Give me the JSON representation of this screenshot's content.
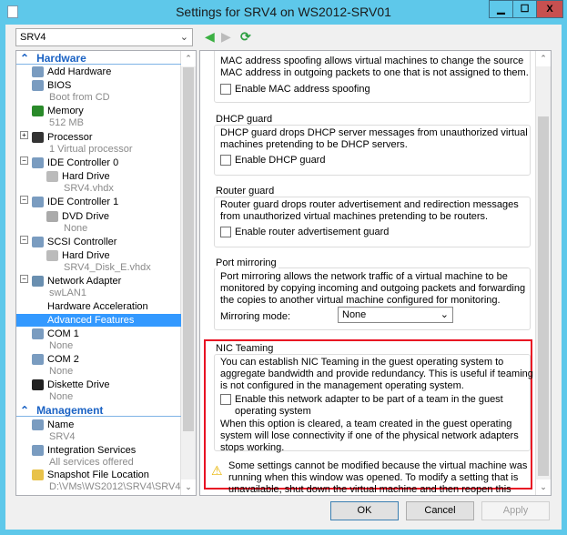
{
  "window": {
    "title": "Settings for SRV4 on WS2012-SRV01",
    "minimize": "▁",
    "maximize": "☐",
    "close": "X"
  },
  "vm_selector": {
    "value": "SRV4"
  },
  "tree": {
    "sections": {
      "hardware": "Hardware",
      "management": "Management"
    },
    "items": [
      {
        "label": "Add Hardware",
        "sub": null,
        "icon": "add-hardware-icon"
      },
      {
        "label": "BIOS",
        "sub": "Boot from CD",
        "icon": "bios-icon"
      },
      {
        "label": "Memory",
        "sub": "512 MB",
        "icon": "memory-icon"
      },
      {
        "label": "Processor",
        "sub": "1 Virtual processor",
        "icon": "processor-icon"
      },
      {
        "label": "IDE Controller 0",
        "icon": "ide-controller-icon"
      },
      {
        "label": "Hard Drive",
        "sub": "SRV4.vhdx",
        "icon": "hard-drive-icon"
      },
      {
        "label": "IDE Controller 1",
        "icon": "ide-controller-icon"
      },
      {
        "label": "DVD Drive",
        "sub": "None",
        "icon": "dvd-drive-icon"
      },
      {
        "label": "SCSI Controller",
        "icon": "scsi-controller-icon"
      },
      {
        "label": "Hard Drive",
        "sub": "SRV4_Disk_E.vhdx",
        "icon": "hard-drive-icon"
      },
      {
        "label": "Network Adapter",
        "sub": "swLAN1",
        "icon": "network-adapter-icon"
      },
      {
        "label": "Hardware Acceleration"
      },
      {
        "label": "Advanced Features",
        "selected": true
      },
      {
        "label": "COM 1",
        "sub": "None",
        "icon": "com-port-icon"
      },
      {
        "label": "COM 2",
        "sub": "None",
        "icon": "com-port-icon"
      },
      {
        "label": "Diskette Drive",
        "sub": "None",
        "icon": "diskette-icon"
      },
      {
        "label": "Name",
        "sub": "SRV4",
        "icon": "name-icon"
      },
      {
        "label": "Integration Services",
        "sub": "All services offered",
        "icon": "integration-services-icon"
      },
      {
        "label": "Snapshot File Location",
        "sub": "D:\\VMs\\WS2012\\SRV4\\SRV4",
        "icon": "snapshot-folder-icon"
      }
    ]
  },
  "content": {
    "mac": {
      "text": "MAC address spoofing allows virtual machines to change the source MAC address in outgoing packets to one that is not assigned to them.",
      "checkbox": "Enable MAC address spoofing"
    },
    "dhcp": {
      "title": "DHCP guard",
      "text": "DHCP guard drops DHCP server messages from unauthorized virtual machines pretending to be DHCP servers.",
      "checkbox": "Enable DHCP guard"
    },
    "router": {
      "title": "Router guard",
      "text": "Router guard drops router advertisement and redirection messages from unauthorized virtual machines pretending to be routers.",
      "checkbox": "Enable router advertisement guard"
    },
    "mirror": {
      "title": "Port mirroring",
      "text": "Port mirroring allows the network traffic of a virtual machine to be monitored by copying incoming and outgoing packets and forwarding the copies to another virtual machine configured for monitoring.",
      "mode_label": "Mirroring mode:",
      "mode_value": "None"
    },
    "nic": {
      "title": "NIC Teaming",
      "text": "You can establish NIC Teaming in the guest operating system to aggregate bandwidth and provide redundancy. This is useful if teaming is not configured in the management operating system.",
      "checkbox": "Enable this network adapter to be part of a team in the guest operating system",
      "note": "When this option is cleared, a team created in the guest operating system will lose connectivity if one of the physical network adapters stops working."
    },
    "warning": "Some settings cannot be modified because the virtual machine was running when this window was opened. To modify a setting that is unavailable, shut down the virtual machine and then reopen this window."
  },
  "buttons": {
    "ok": "OK",
    "cancel": "Cancel",
    "apply": "Apply"
  },
  "colors": {
    "highlight": "#e81123",
    "selection": "#3399ff",
    "section": "#1a62c4"
  }
}
